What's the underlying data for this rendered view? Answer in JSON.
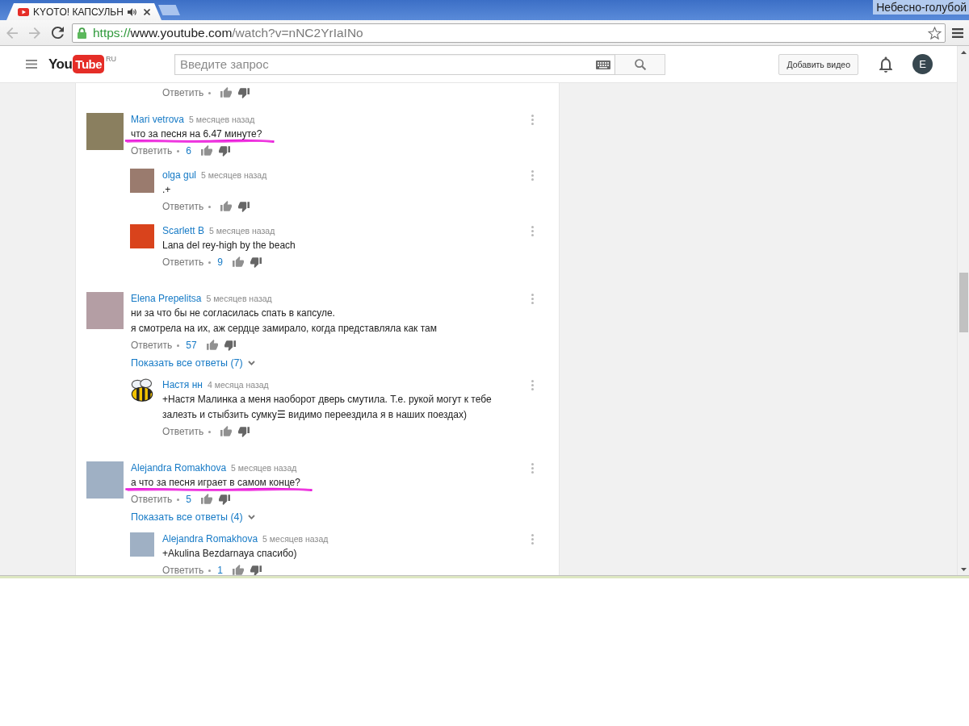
{
  "tooltip": "Небесно-голубой",
  "tabs": [
    {
      "title": "KYOTO! КАПСУЛЬН",
      "selected": true,
      "playing_audio": true
    }
  ],
  "nav_buttons": [
    {
      "kind": "back",
      "disabled": true
    },
    {
      "kind": "forward",
      "disabled": true
    },
    {
      "kind": "reload",
      "disabled": false
    }
  ],
  "address_bar": {
    "secure": true,
    "scheme": "https://",
    "host": "www.youtube.com",
    "path": "/watch?v=nNC2YrIaINo"
  },
  "site_header": {
    "logo": {
      "left": "You",
      "right": "Tube",
      "region": "RU"
    },
    "search": {
      "placeholder": "Введите запрос"
    },
    "upload_button": "Добавить видео",
    "account_initial": "E"
  },
  "previous_comment_actions": {
    "reply_label": "Ответить"
  },
  "comments": [
    {
      "author": "Mari vetrova",
      "time": "5 месяцев назад",
      "text": "что за песня на 6.47 минуте?",
      "underlined": true,
      "avatar": {
        "kind": "photo",
        "color": "#8a7f5f"
      },
      "reply_label": "Ответить",
      "likes": "6",
      "replies": [
        {
          "author": "olga gul",
          "time": "5 месяцев назад",
          "text": ".+",
          "underlined": false,
          "avatar": {
            "kind": "photo",
            "color": "#9a7b6e"
          },
          "reply_label": "Ответить"
        },
        {
          "author": "Scarlett B",
          "time": "5 месяцев назад",
          "text": "Lana del rey-high by the beach",
          "underlined": false,
          "avatar": {
            "kind": "photo",
            "color": "#d9431c"
          },
          "reply_label": "Ответить",
          "likes": "9"
        }
      ]
    },
    {
      "author": "Elena Prepelitsa",
      "time": "5 месяцев назад",
      "text": "ни за что бы не согласилась спать в капсуле.\nя смотрела на их, аж сердце замирало, когда представляла как там",
      "underlined": false,
      "avatar": {
        "kind": "photo",
        "color": "#b49ea4"
      },
      "reply_label": "Ответить",
      "likes": "57",
      "show_replies": "Показать все ответы (7)",
      "replies": [
        {
          "author": "Настя нн",
          "time": "4 месяца назад",
          "text": "+Настя Малинка а меня наоборот дверь смутила. Т.е. рукой могут к тебе залезть и стыбзить сумку☰ видимо переездила я в наших поездах)",
          "underlined": false,
          "avatar": {
            "kind": "drawing"
          },
          "reply_label": "Ответить"
        }
      ]
    },
    {
      "author": "Alejandra Romakhova",
      "time": "5 месяцев назад",
      "text": "а что за песня играет в самом конце?",
      "underlined": true,
      "avatar": {
        "kind": "photo",
        "color": "#9fb0c4"
      },
      "reply_label": "Ответить",
      "likes": "5",
      "show_replies": "Показать все ответы (4)",
      "replies": [
        {
          "author": "Alejandra Romakhova",
          "time": "5 месяцев назад",
          "text": "+Akulina Bezdarnaya спасибо)",
          "underlined": false,
          "avatar": {
            "kind": "photo",
            "color": "#9fb0c4"
          },
          "reply_label": "Ответить",
          "likes": "1"
        }
      ]
    }
  ]
}
